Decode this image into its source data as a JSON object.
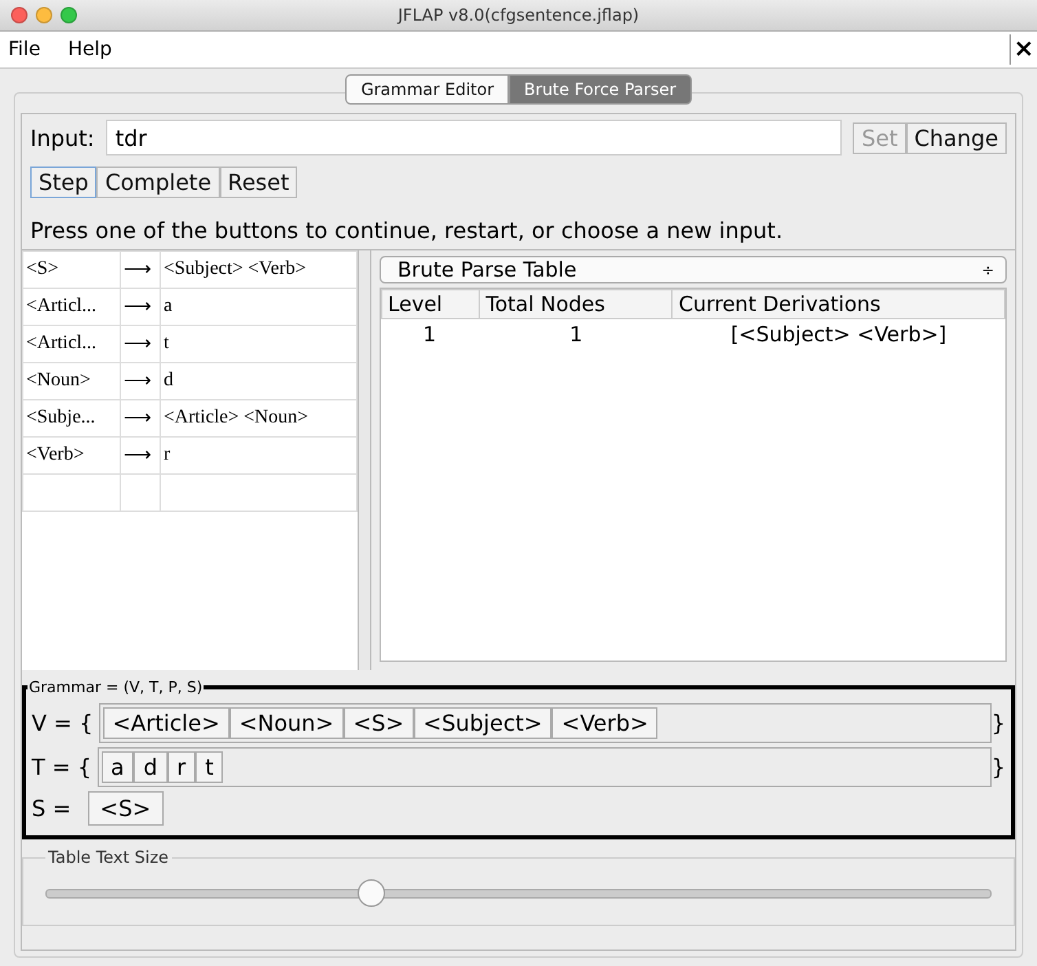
{
  "window": {
    "title": "JFLAP v8.0(cfgsentence.jflap)"
  },
  "menu": [
    "File",
    "Help"
  ],
  "close_glyph": "×",
  "tabs": [
    {
      "label": "Grammar Editor",
      "selected": false
    },
    {
      "label": "Brute Force Parser",
      "selected": true
    }
  ],
  "input": {
    "label": "Input:",
    "value": "tdr"
  },
  "input_buttons": [
    {
      "label": "Set",
      "disabled": true
    },
    {
      "label": "Change",
      "disabled": false
    }
  ],
  "actions": [
    {
      "label": "Step",
      "focused": true
    },
    {
      "label": "Complete",
      "focused": false
    },
    {
      "label": "Reset",
      "focused": false
    }
  ],
  "message": "Press one of the buttons to continue, restart, or choose a new input.",
  "productions": [
    {
      "lhs": "<S>",
      "arrow": "⟶",
      "rhs": "<Subject> <Verb>"
    },
    {
      "lhs": "<Articl...",
      "arrow": "⟶",
      "rhs": "a"
    },
    {
      "lhs": "<Articl...",
      "arrow": "⟶",
      "rhs": "t"
    },
    {
      "lhs": "<Noun>",
      "arrow": "⟶",
      "rhs": "d"
    },
    {
      "lhs": "<Subje...",
      "arrow": "⟶",
      "rhs": "<Article> <Noun>"
    },
    {
      "lhs": "<Verb>",
      "arrow": "⟶",
      "rhs": "r"
    }
  ],
  "view_select": {
    "value": "Brute Parse Table",
    "glyph": "÷"
  },
  "parse_table": {
    "columns": [
      "Level",
      "Total Nodes",
      "Current Derivations"
    ],
    "rows": [
      [
        "1",
        "1",
        "[<Subject> <Verb>]"
      ]
    ]
  },
  "grammar": {
    "title": "Grammar = (V, T, P, S)",
    "sets": [
      {
        "label": "V = {",
        "close": "}",
        "items": [
          "<Article>",
          "<Noun>",
          "<S>",
          "<Subject>",
          "<Verb>"
        ]
      },
      {
        "label": "T = {",
        "close": "}",
        "items": [
          "a",
          "d",
          "r",
          "t"
        ]
      }
    ],
    "start": {
      "label": "S =",
      "value": "<S>"
    }
  },
  "text_size": {
    "title": "Table Text Size",
    "level": 0.34
  }
}
